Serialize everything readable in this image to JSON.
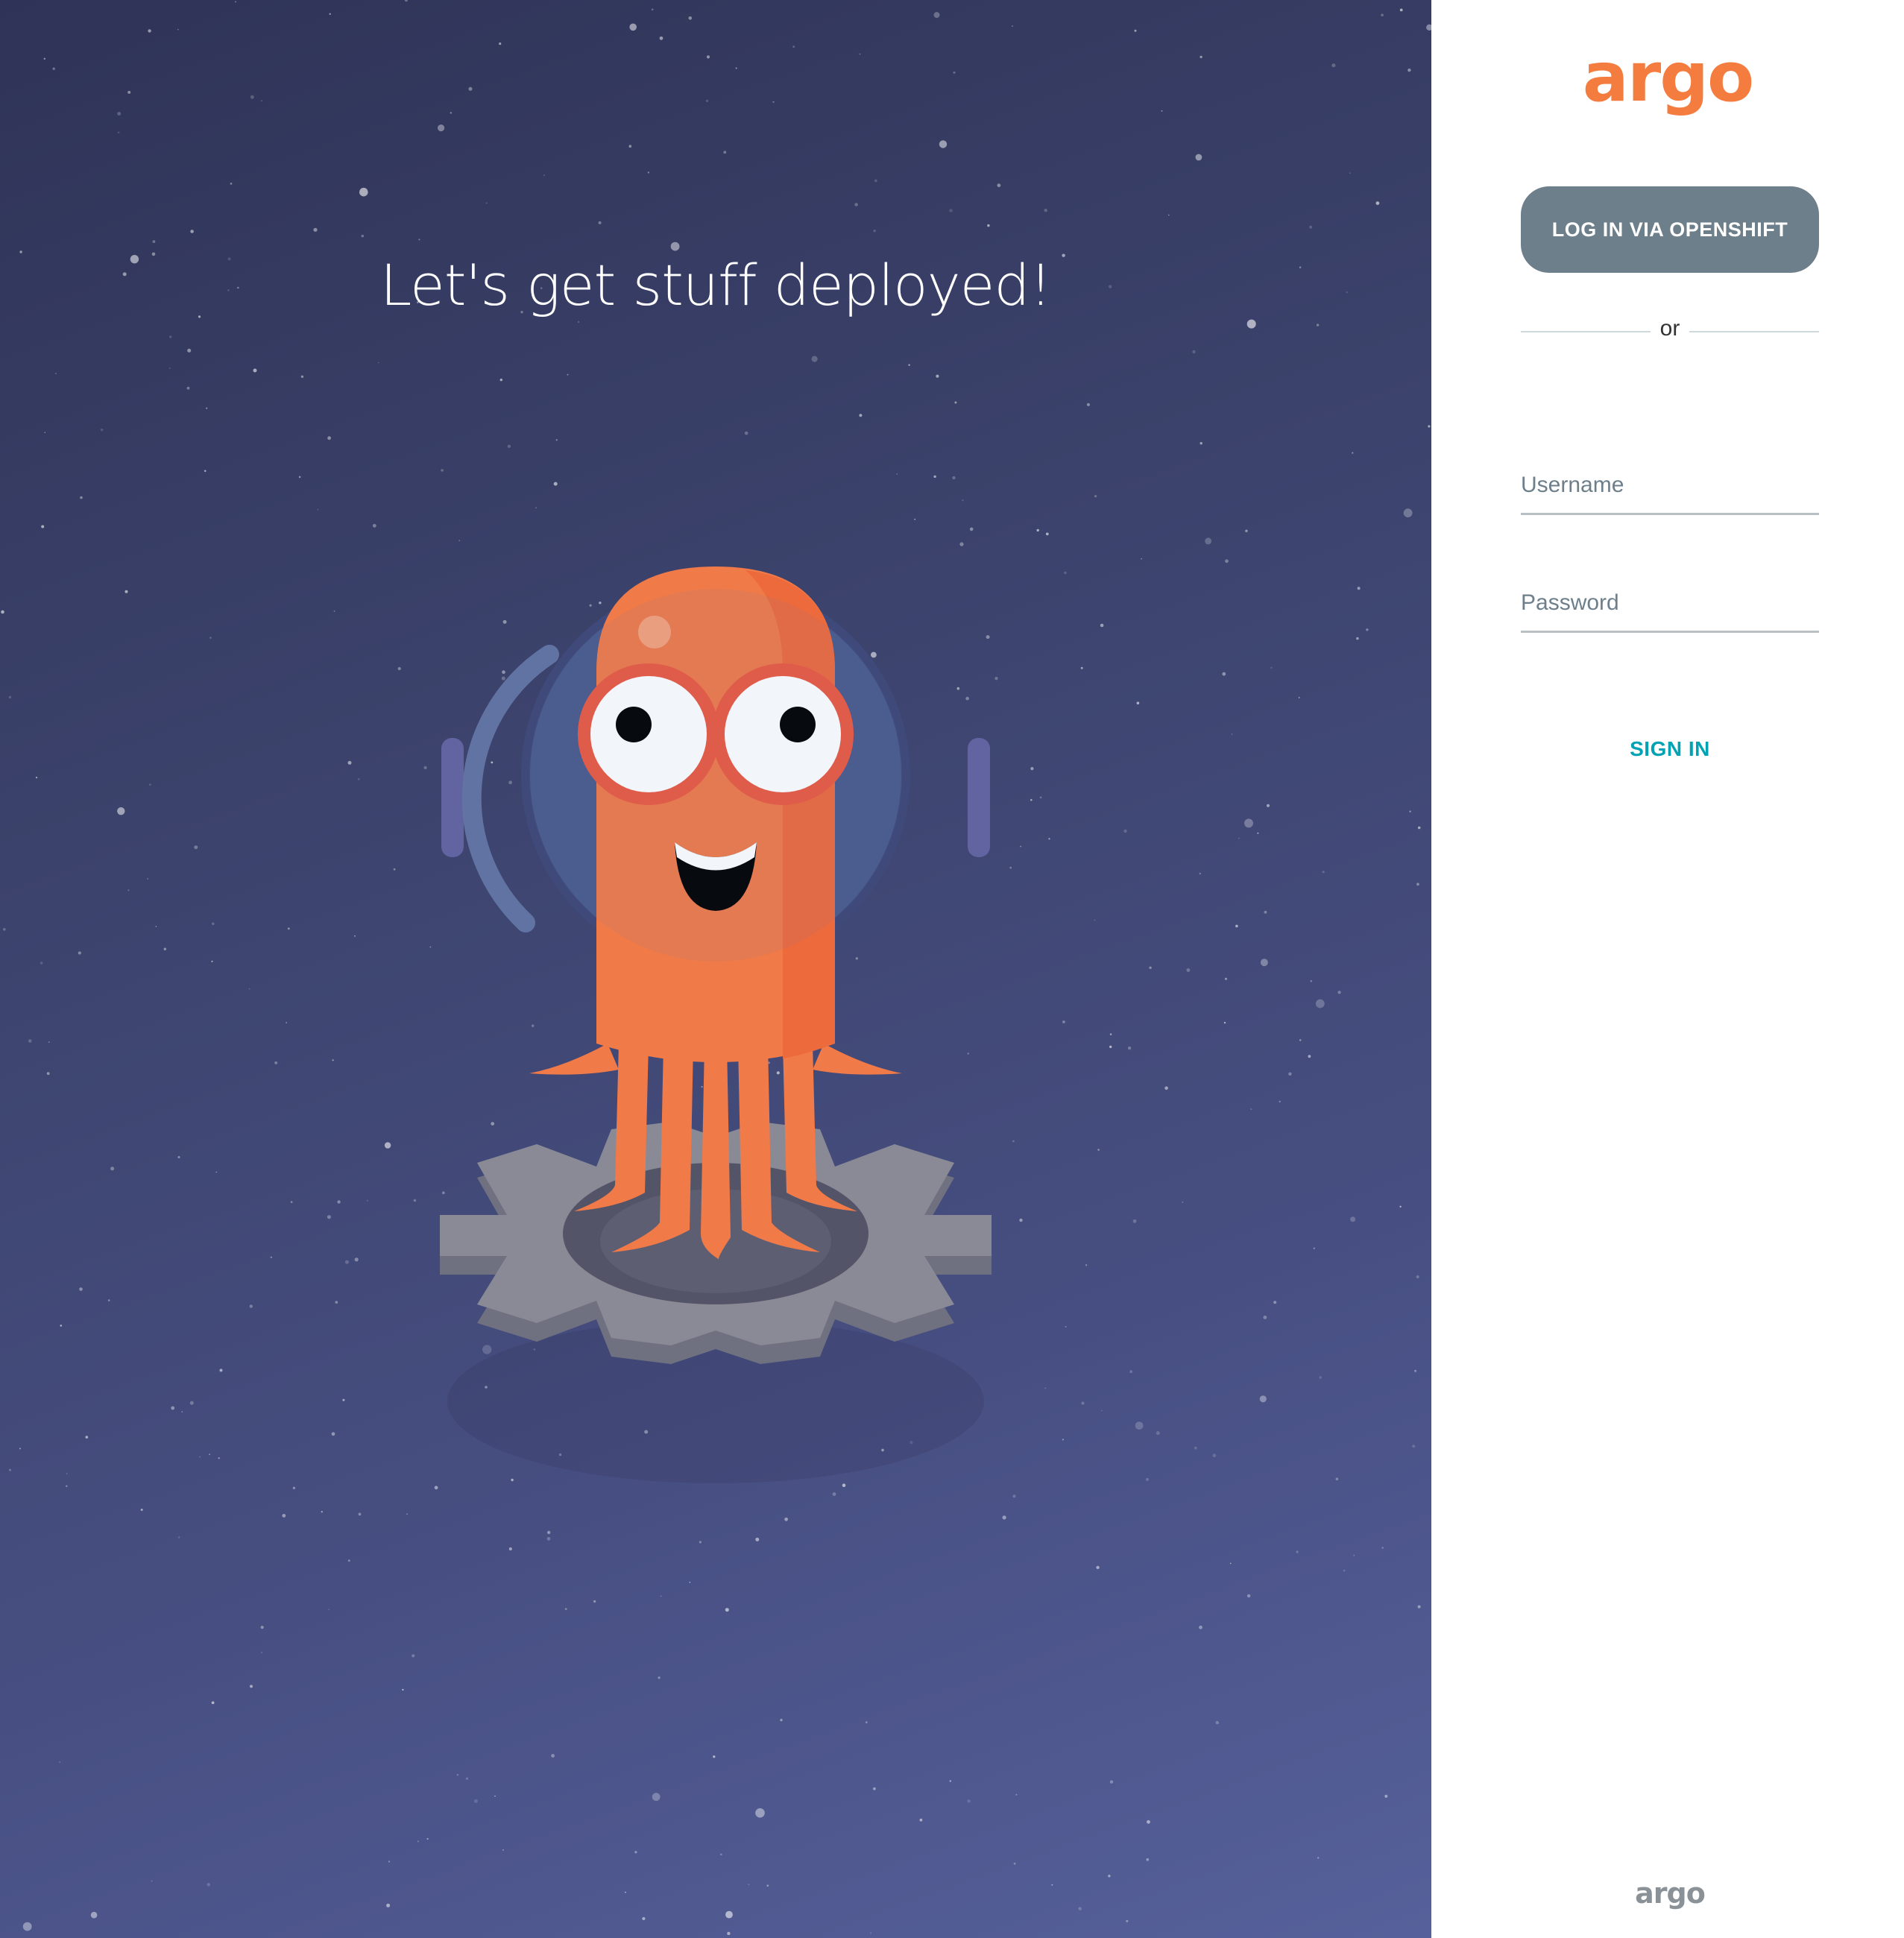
{
  "hero": {
    "tagline": "Let's get stuff deployed!",
    "illustration": "argo-octopus-astronaut-on-gear"
  },
  "login": {
    "logo_text": "argo",
    "sso_button_label": "LOG IN VIA OPENSHIFT",
    "divider_text": "or",
    "username_placeholder": "Username",
    "password_placeholder": "Password",
    "signin_label": "SIGN IN",
    "footer_logo_text": "argo"
  },
  "colors": {
    "brand_orange": "#f37c3e",
    "sso_button_bg": "#6d7f8b",
    "signin_text": "#00a2b3",
    "hero_bg_top": "#2f3357",
    "hero_bg_bottom": "#56609a"
  }
}
